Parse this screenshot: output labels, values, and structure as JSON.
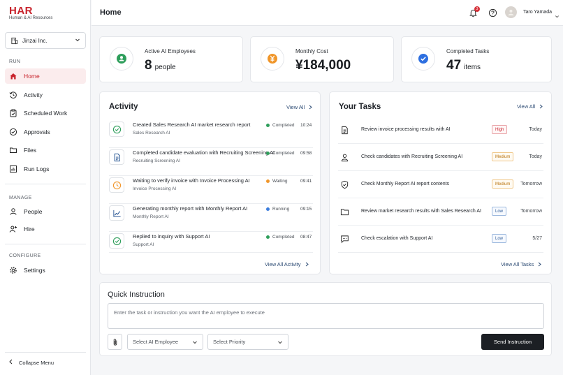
{
  "app": {
    "logo_text": "HAR",
    "logo_sub": "Human & AI Resources"
  },
  "sidebar": {
    "org": "Jinzai Inc.",
    "sections": [
      {
        "title": "RUN"
      },
      {
        "title": "MANAGE"
      },
      {
        "title": "CONFIGURE"
      }
    ],
    "items": [
      {
        "label": "Home",
        "icon": "home-icon",
        "active": true
      },
      {
        "label": "Activity",
        "icon": "history-icon"
      },
      {
        "label": "Scheduled Work",
        "icon": "clipboard-icon"
      },
      {
        "label": "Approvals",
        "icon": "check-circle-icon"
      },
      {
        "label": "Files",
        "icon": "folder-icon"
      },
      {
        "label": "Run Logs",
        "icon": "chart-icon"
      },
      {
        "label": "People",
        "icon": "person-icon"
      },
      {
        "label": "Hire",
        "icon": "add-person-icon"
      },
      {
        "label": "Settings",
        "icon": "gear-icon"
      }
    ],
    "collapse_label": "Collapse Menu"
  },
  "header": {
    "title": "Home",
    "notification_count": "3",
    "user_name": "Taro Yamada"
  },
  "stats": [
    {
      "label": "Active AI Employees",
      "value": "8",
      "unit": "people",
      "icon": "person-icon",
      "color": "#2e9e5b"
    },
    {
      "label": "Monthly Cost",
      "value": "¥184,000",
      "unit": "",
      "icon": "yen-icon",
      "color": "#f0962a"
    },
    {
      "label": "Completed Tasks",
      "value": "47",
      "unit": "items",
      "icon": "check-icon",
      "color": "#2d6fe0"
    }
  ],
  "activity": {
    "title": "Activity",
    "view_all": "View All",
    "view_all_bottom": "View All Activity",
    "rows": [
      {
        "title": "Created Sales Research AI market research report",
        "sub": "Sales Research AI",
        "status": "Completed",
        "status_color": "#2e9e5b",
        "time": "10:24",
        "icon": "check-circle-icon"
      },
      {
        "title": "Completed candidate evaluation with Recruiting Screening AI",
        "sub": "Recruiting Screening AI",
        "status": "Completed",
        "status_color": "#2e9e5b",
        "time": "09:58",
        "icon": "document-icon"
      },
      {
        "title": "Waiting to verify invoice with Invoice Processing AI",
        "sub": "Invoice Processing AI",
        "status": "Waiting",
        "status_color": "#f0962a",
        "time": "09:41",
        "icon": "clock-icon"
      },
      {
        "title": "Generating monthly report with Monthly Report AI",
        "sub": "Monthly Report AI",
        "status": "Running",
        "status_color": "#3b7ddd",
        "time": "09:15",
        "icon": "line-chart-icon"
      },
      {
        "title": "Replied to inquiry with Support AI",
        "sub": "Support AI",
        "status": "Completed",
        "status_color": "#2e9e5b",
        "time": "08:47",
        "icon": "check-circle-icon"
      }
    ]
  },
  "tasks": {
    "title": "Your Tasks",
    "view_all": "View All",
    "view_all_bottom": "View All Tasks",
    "rows": [
      {
        "title": "Review invoice processing results with AI",
        "priority": "High",
        "level": "high",
        "due": "Today",
        "icon": "document-icon"
      },
      {
        "title": "Check candidates with Recruiting Screening AI",
        "priority": "Medium",
        "level": "medium",
        "due": "Today",
        "icon": "person-icon"
      },
      {
        "title": "Check Monthly Report AI report contents",
        "priority": "Medium",
        "level": "medium",
        "due": "Tomorrow",
        "icon": "shield-check-icon"
      },
      {
        "title": "Review market research results with Sales Research AI",
        "priority": "Low",
        "level": "low",
        "due": "Tomorrow",
        "icon": "folder-icon"
      },
      {
        "title": "Check escalation with Support AI",
        "priority": "Low",
        "level": "low",
        "due": "5/27",
        "icon": "chat-icon"
      }
    ]
  },
  "quick": {
    "title": "Quick Instruction",
    "placeholder": "Enter the task or instruction you want the AI employee to execute",
    "employee_placeholder": "Select AI Employee",
    "priority_placeholder": "Select Priority",
    "send_label": "Send Instruction"
  }
}
